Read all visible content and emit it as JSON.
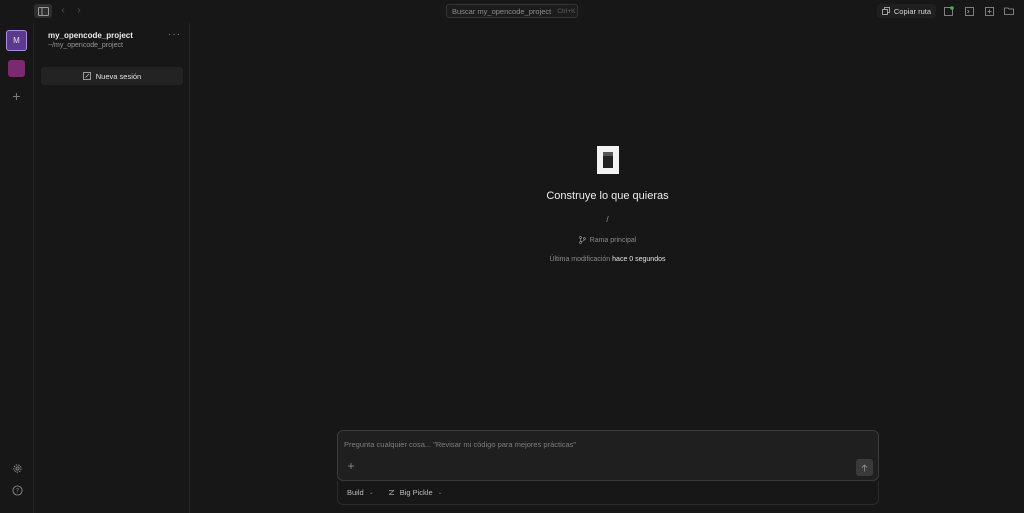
{
  "topbar": {
    "search_placeholder": "Buscar my_opencode_project",
    "search_shortcut": "Ctrl+K",
    "copy_path_label": "Copiar ruta"
  },
  "rail": {
    "project_initial": "M"
  },
  "sidebar": {
    "project_name": "my_opencode_project",
    "project_path": "~/my_opencode_project",
    "more_label": "···",
    "new_session_label": "Nueva sesión"
  },
  "main": {
    "headline": "Construye lo que quieras",
    "directory": "/",
    "branch_label": "Rama principal",
    "modified_prefix": "Última modificación",
    "modified_value": "hace 0 segundos"
  },
  "composer": {
    "placeholder": "Pregunta cualquier cosa... \"Revisar mi código para mejores prácticas\"",
    "agent_label": "Build",
    "model_label": "Big Pickle"
  },
  "colors": {
    "background": "#171717",
    "accent_purple": "#5b3a8c",
    "accent_magenta": "#7a2a6e"
  }
}
